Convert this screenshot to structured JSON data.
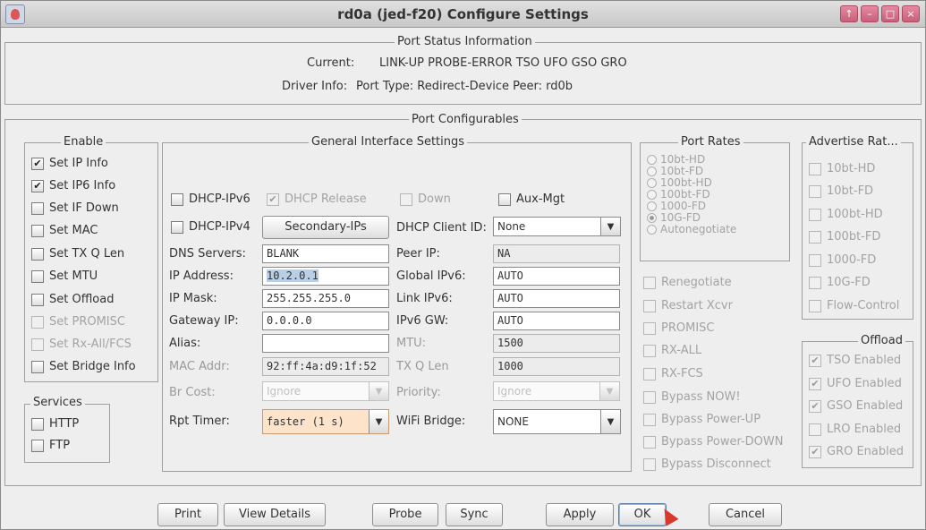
{
  "window": {
    "title": "rd0a  (jed-f20) Configure Settings",
    "controls": [
      "↑",
      "–",
      "□",
      "×"
    ]
  },
  "status": {
    "title": "Port Status Information",
    "current_label": "Current:",
    "current_value": "LINK-UP PROBE-ERROR TSO UFO GSO GRO",
    "driver_label": "Driver Info:",
    "driver_value": "Port Type: Redirect-Device   Peer: rd0b"
  },
  "configurables_title": "Port Configurables",
  "enable": {
    "title": "Enable",
    "items": [
      {
        "label": "Set IP Info",
        "checked": true,
        "enabled": true
      },
      {
        "label": "Set IP6 Info",
        "checked": true,
        "enabled": true
      },
      {
        "label": "Set IF Down",
        "checked": false,
        "enabled": true
      },
      {
        "label": "Set MAC",
        "checked": false,
        "enabled": true
      },
      {
        "label": "Set TX Q Len",
        "checked": false,
        "enabled": true
      },
      {
        "label": "Set MTU",
        "checked": false,
        "enabled": true
      },
      {
        "label": "Set Offload",
        "checked": false,
        "enabled": true
      },
      {
        "label": "Set PROMISC",
        "checked": false,
        "enabled": false
      },
      {
        "label": "Set Rx-All/FCS",
        "checked": false,
        "enabled": false
      },
      {
        "label": "Set Bridge Info",
        "checked": false,
        "enabled": true
      }
    ]
  },
  "services": {
    "title": "Services",
    "items": [
      {
        "label": "HTTP",
        "checked": false
      },
      {
        "label": "FTP",
        "checked": false
      }
    ]
  },
  "general": {
    "title": "General Interface Settings",
    "dhcp_ipv6": "DHCP-IPv6",
    "dhcp_release": "DHCP Release",
    "down": "Down",
    "aux_mgt": "Aux-Mgt",
    "dhcp_ipv4": "DHCP-IPv4",
    "secondary_ips": "Secondary-IPs",
    "dhcp_client_id_label": "DHCP Client ID:",
    "dhcp_client_id": "None",
    "dns_label": "DNS Servers:",
    "dns": "BLANK",
    "peer_ip_label": "Peer IP:",
    "peer_ip": "NA",
    "ip_label": "IP Address:",
    "ip": "10.2.0.1",
    "global_ipv6_label": "Global IPv6:",
    "global_ipv6": "AUTO",
    "mask_label": "IP Mask:",
    "mask": "255.255.255.0",
    "link_ipv6_label": "Link IPv6:",
    "link_ipv6": "AUTO",
    "gw_label": "Gateway IP:",
    "gw": "0.0.0.0",
    "ipv6_gw_label": "IPv6 GW:",
    "ipv6_gw": "AUTO",
    "alias_label": "Alias:",
    "alias": "",
    "mtu_label": "MTU:",
    "mtu": "1500",
    "mac_label": "MAC Addr:",
    "mac": "92:ff:4a:d9:1f:52",
    "txq_label": "TX Q Len",
    "txq": "1000",
    "brcost_label": "Br Cost:",
    "brcost": "Ignore",
    "priority_label": "Priority:",
    "priority": "Ignore",
    "rpt_label": "Rpt Timer:",
    "rpt": "faster  (1 s)",
    "wifi_label": "WiFi Bridge:",
    "wifi": "NONE"
  },
  "port_rates": {
    "title": "Port Rates",
    "options": [
      {
        "label": "10bt-HD",
        "selected": false
      },
      {
        "label": "10bt-FD",
        "selected": false
      },
      {
        "label": "100bt-HD",
        "selected": false
      },
      {
        "label": "100bt-FD",
        "selected": false
      },
      {
        "label": "1000-FD",
        "selected": false
      },
      {
        "label": "10G-FD",
        "selected": true
      },
      {
        "label": "Autonegotiate",
        "selected": false
      }
    ]
  },
  "misc_checks": [
    "Renegotiate",
    "Restart Xcvr",
    "PROMISC",
    "RX-ALL",
    "RX-FCS",
    "Bypass NOW!",
    "Bypass Power-UP",
    "Bypass Power-DOWN",
    "Bypass Disconnect"
  ],
  "advertise": {
    "title": "Advertise Rat...",
    "items": [
      "10bt-HD",
      "10bt-FD",
      "100bt-HD",
      "100bt-FD",
      "1000-FD",
      "10G-FD",
      "Flow-Control"
    ]
  },
  "offload": {
    "title": "Offload",
    "items": [
      {
        "label": "TSO Enabled",
        "checked": true
      },
      {
        "label": "UFO Enabled",
        "checked": true
      },
      {
        "label": "GSO Enabled",
        "checked": true
      },
      {
        "label": "LRO Enabled",
        "checked": false
      },
      {
        "label": "GRO Enabled",
        "checked": true
      }
    ]
  },
  "buttons": {
    "print": "Print",
    "view_details": "View Details",
    "probe": "Probe",
    "sync": "Sync",
    "apply": "Apply",
    "ok": "OK",
    "cancel": "Cancel"
  },
  "colors": {
    "title_controls": "#c85f7b",
    "rpt_timer_bg": "#fce3c9",
    "selection": "#b8cfe5"
  }
}
